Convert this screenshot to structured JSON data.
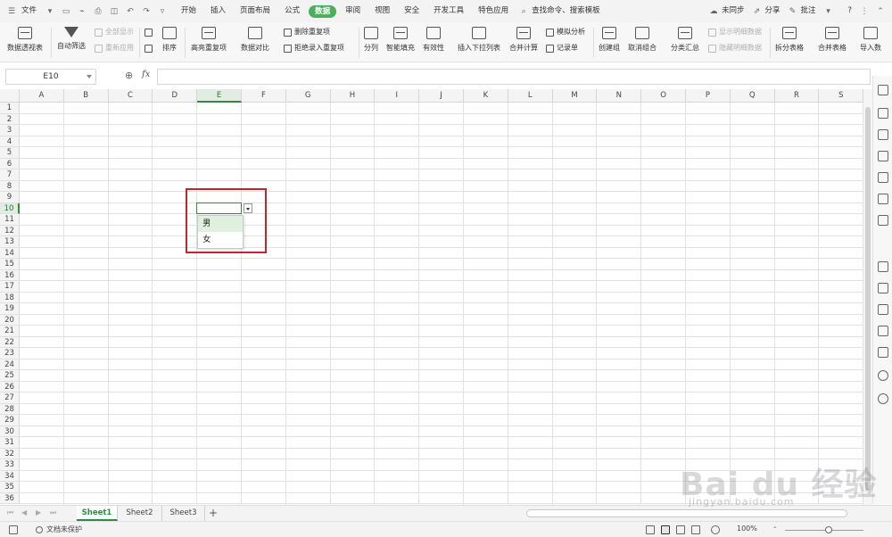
{
  "menubar": {
    "file_label": "文件",
    "tabs": [
      "开始",
      "插入",
      "页面布局",
      "公式",
      "数据",
      "审阅",
      "视图",
      "安全",
      "开发工具",
      "特色应用"
    ],
    "active_tab": "数据",
    "search_placeholder": "查找命令、搜索模板",
    "sync_label": "未同步",
    "share_label": "分享",
    "comment_label": "批注",
    "help_label": "?"
  },
  "ribbon": {
    "pivot": "数据透视表",
    "autofilter": "自动筛选",
    "show_all": "全部显示",
    "reapply": "重新应用",
    "sort": "排序",
    "highlight_dup": "高亮重复项",
    "data_compare": "数据对比",
    "delete_dup": "删除重复项",
    "reject_dup": "拒绝录入重复项",
    "split": "分列",
    "smart_fill": "智能填充",
    "validity": "有效性",
    "insert_dropdown": "插入下拉列表",
    "consolidate": "合并计算",
    "simulate": "模拟分析",
    "record": "记录单",
    "create_group": "创建组",
    "ungroup": "取消组合",
    "subtotal": "分类汇总",
    "show_detail": "显示明细数据",
    "hide_detail": "隐藏明细数据",
    "split_table": "拆分表格",
    "merge_table": "合并表格",
    "import_data": "导入数"
  },
  "formula_bar": {
    "name_box": "E10",
    "fx": "fx",
    "formula_value": ""
  },
  "grid": {
    "columns": [
      "A",
      "B",
      "C",
      "D",
      "E",
      "F",
      "G",
      "H",
      "I",
      "J",
      "K",
      "L",
      "M",
      "N",
      "O",
      "P",
      "Q",
      "R",
      "S"
    ],
    "rows": [
      "1",
      "2",
      "3",
      "4",
      "5",
      "6",
      "7",
      "8",
      "9",
      "10",
      "11",
      "12",
      "13",
      "14",
      "15",
      "16",
      "17",
      "18",
      "19",
      "20",
      "21",
      "22",
      "23",
      "24",
      "25",
      "26",
      "27",
      "28",
      "29",
      "30",
      "31",
      "32",
      "33",
      "34",
      "35",
      "36"
    ],
    "selected_column": "E",
    "selected_row": "10"
  },
  "dropdown": {
    "options": [
      "男",
      "女"
    ],
    "highlighted": "男"
  },
  "sheets": {
    "tabs": [
      "Sheet1",
      "Sheet2",
      "Sheet3"
    ],
    "active": "Sheet1",
    "add_label": "+"
  },
  "statusbar": {
    "protect": "文档未保护",
    "zoom": "100%",
    "zoom_minus": "-"
  },
  "watermark": {
    "logo_text": "Bai du 经验",
    "url": "jingyan.baidu.com"
  },
  "colors": {
    "accent": "#2f8c43",
    "active_tab_bg": "#4daf5c",
    "highlight_box": "#c0272d",
    "option_highlight": "#dff0de"
  }
}
